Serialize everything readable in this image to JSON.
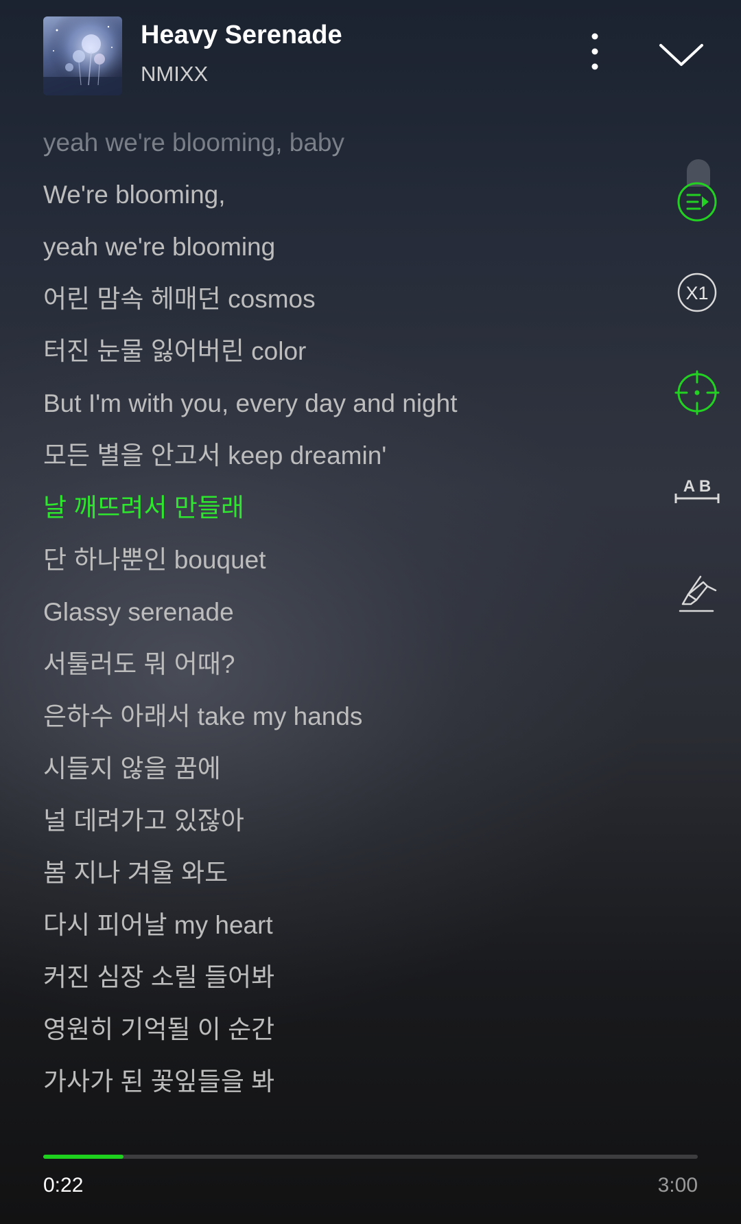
{
  "header": {
    "song_title": "Heavy Serenade",
    "artist": "NMIXX",
    "album_art": "album-cover-image",
    "more_icon": "more-vertical-icon",
    "collapse_icon": "chevron-down-icon"
  },
  "lyrics": {
    "active_index": 7,
    "lines": [
      "yeah we're blooming, baby",
      "We're blooming,",
      "yeah we're blooming",
      "어린 맘속 헤매던 cosmos",
      "터진 눈물 잃어버린 color",
      "But I'm with you, every day and night",
      "모든 별을 안고서 keep dreamin'",
      "날 깨뜨려서 만들래",
      "단 하나뿐인 bouquet",
      "Glassy serenade",
      "서툴러도 뭐 어때?",
      "은하수 아래서 take my hands",
      "시들지 않을 꿈에",
      "널 데려가고 있잖아",
      "봄 지나 겨울 와도",
      "다시 피어날 my heart",
      "커진 심장 소릴 들어봐",
      "영원히 기억될 이 순간",
      "가사가 된 꽃잎들을 봐"
    ]
  },
  "side_tools": [
    {
      "name": "playlist-play-icon",
      "label": ""
    },
    {
      "name": "speed-x1-icon",
      "label": "X1"
    },
    {
      "name": "sync-target-icon",
      "label": ""
    },
    {
      "name": "ab-repeat-icon",
      "label": "A B"
    },
    {
      "name": "highlighter-icon",
      "label": ""
    }
  ],
  "playback": {
    "current_time": "0:22",
    "total_time": "3:00",
    "progress_fraction": 0.1222
  },
  "colors": {
    "accent": "#1fd11f",
    "active_lyric": "#2ee62e",
    "lyric_text": "#bdbdbd",
    "title_text": "#ffffff"
  }
}
